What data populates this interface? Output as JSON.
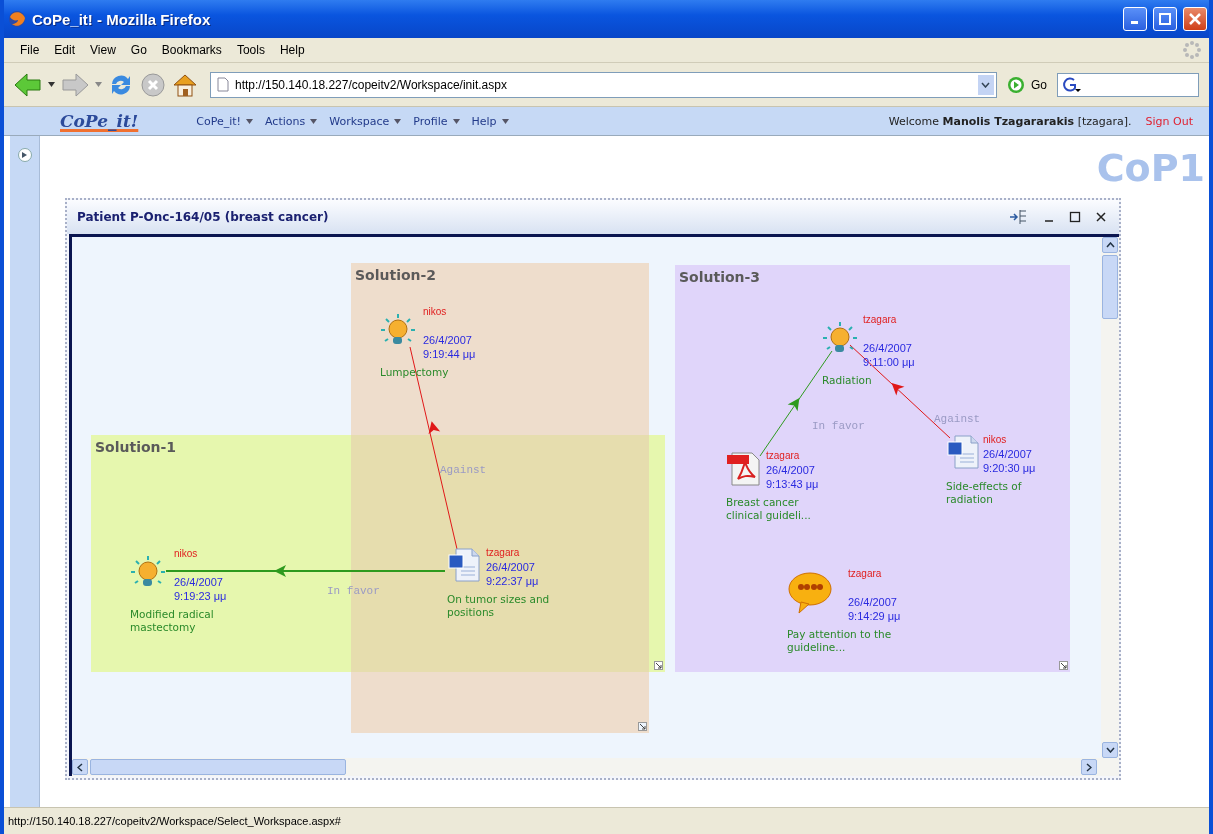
{
  "window": {
    "title": "CoPe_it! - Mozilla Firefox"
  },
  "menu_bar": [
    "File",
    "Edit",
    "View",
    "Go",
    "Bookmarks",
    "Tools",
    "Help"
  ],
  "nav_bar": {
    "address": "http://150.140.18.227/copeitv2/Workspace/init.aspx",
    "go_label": "Go"
  },
  "app_header": {
    "logo": "CoPe_it!",
    "menus": [
      "CoPe_it!",
      "Actions",
      "Workspace",
      "Profile",
      "Help"
    ],
    "greeting": "Welcome **Manolis Tzagararakis** [tzagara].",
    "sign_out": "Sign Out"
  },
  "workspace_name": "CoP1",
  "panel": {
    "title": "Patient P-Onc-164/05 (breast cancer)",
    "regions": [
      {
        "title": "Solution-1",
        "color": "#e6f7ae"
      },
      {
        "title": "Solution-2",
        "color": "#f8ddcc"
      },
      {
        "title": "Solution-3",
        "color": "#e0d5fa"
      }
    ],
    "nodes": [
      {
        "kind": "idea",
        "author": "nikos",
        "date": "26/4/2007",
        "time": "9:19:44 μμ",
        "label": "Lumpectomy"
      },
      {
        "kind": "idea",
        "author": "nikos",
        "date": "26/4/2007",
        "time": "9:19:23 μμ",
        "label": "Modified radical mastectomy"
      },
      {
        "kind": "document",
        "author": "tzagara",
        "date": "26/4/2007",
        "time": "9:22:37 μμ",
        "label": "On tumor sizes and positions"
      },
      {
        "kind": "idea",
        "author": "tzagara",
        "date": "26/4/2007",
        "time": "9:11:00 μμ",
        "label": "Radiation"
      },
      {
        "kind": "pdf",
        "author": "tzagara",
        "date": "26/4/2007",
        "time": "9:13:43 μμ",
        "label": "Breast cancer clinical guideli..."
      },
      {
        "kind": "document",
        "author": "nikos",
        "date": "26/4/2007",
        "time": "9:20:30 μμ",
        "label": "Side-effects of radiation"
      },
      {
        "kind": "comment",
        "author": "tzagara",
        "date": "26/4/2007",
        "time": "9:14:29 μμ",
        "label": "Pay attention to the guideline..."
      }
    ],
    "edges": [
      {
        "kind": "against",
        "label": "Against"
      },
      {
        "kind": "favor",
        "label": "In favor"
      },
      {
        "kind": "favor",
        "label": "In favor"
      },
      {
        "kind": "against",
        "label": "Against"
      }
    ]
  },
  "status_bar": "http://150.140.18.227/copeitv2/Workspace/Select_Workspace.aspx#"
}
